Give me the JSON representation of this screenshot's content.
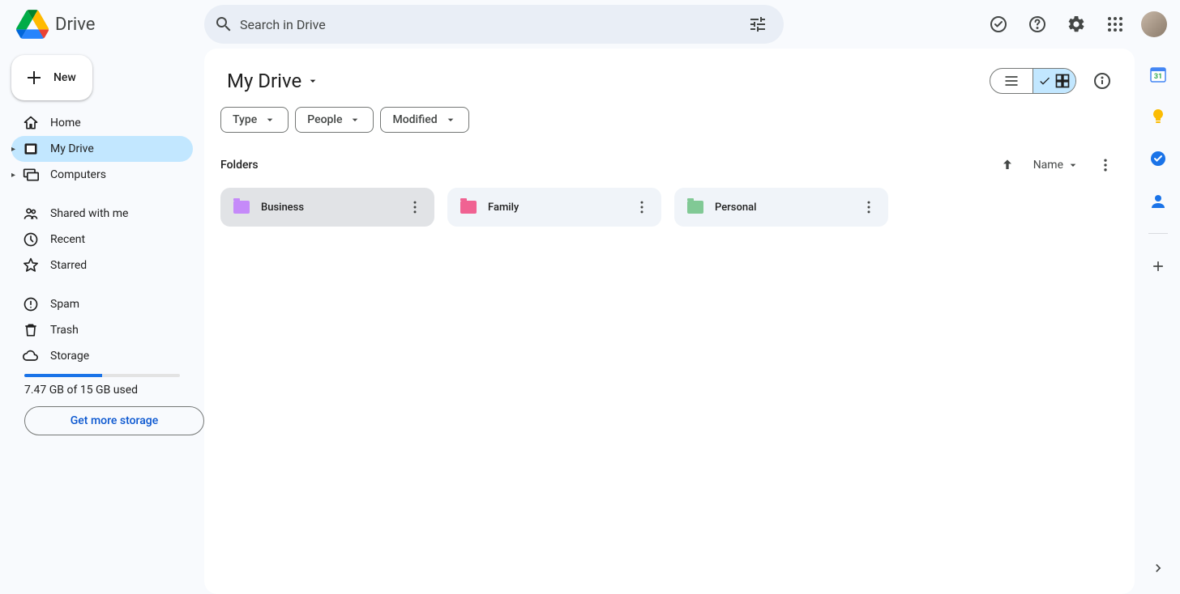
{
  "app": {
    "name": "Drive"
  },
  "search": {
    "placeholder": "Search in Drive"
  },
  "new_button": {
    "label": "New"
  },
  "sidebar": {
    "items": [
      {
        "label": "Home",
        "icon": "home",
        "active": false,
        "expandable": false
      },
      {
        "label": "My Drive",
        "icon": "drive",
        "active": true,
        "expandable": true
      },
      {
        "label": "Computers",
        "icon": "computers",
        "active": false,
        "expandable": true
      },
      {
        "label": "Shared with me",
        "icon": "shared",
        "active": false,
        "expandable": false,
        "gap_before": true
      },
      {
        "label": "Recent",
        "icon": "recent",
        "active": false,
        "expandable": false
      },
      {
        "label": "Starred",
        "icon": "starred",
        "active": false,
        "expandable": false
      },
      {
        "label": "Spam",
        "icon": "spam",
        "active": false,
        "expandable": false,
        "gap_before": true
      },
      {
        "label": "Trash",
        "icon": "trash",
        "active": false,
        "expandable": false
      },
      {
        "label": "Storage",
        "icon": "storage",
        "active": false,
        "expandable": false
      }
    ],
    "storage": {
      "text": "7.47 GB of 15 GB used",
      "percent": 49.8,
      "cta": "Get more storage"
    }
  },
  "main": {
    "title": "My Drive",
    "filters": [
      {
        "label": "Type"
      },
      {
        "label": "People"
      },
      {
        "label": "Modified"
      }
    ],
    "view_mode": "grid",
    "section_label": "Folders",
    "sort": {
      "direction": "asc",
      "by": "Name"
    },
    "folders": [
      {
        "name": "Business",
        "color": "#c58af9",
        "selected": true
      },
      {
        "name": "Family",
        "color": "#f06292",
        "selected": false
      },
      {
        "name": "Personal",
        "color": "#81c995",
        "selected": false
      }
    ]
  },
  "sidepanel": {
    "apps": [
      {
        "name": "calendar",
        "color": "#34a853",
        "accent": "#4285f4"
      },
      {
        "name": "keep",
        "color": "#fbbc04"
      },
      {
        "name": "tasks",
        "color": "#1a73e8"
      },
      {
        "name": "contacts",
        "color": "#1a73e8"
      }
    ]
  }
}
